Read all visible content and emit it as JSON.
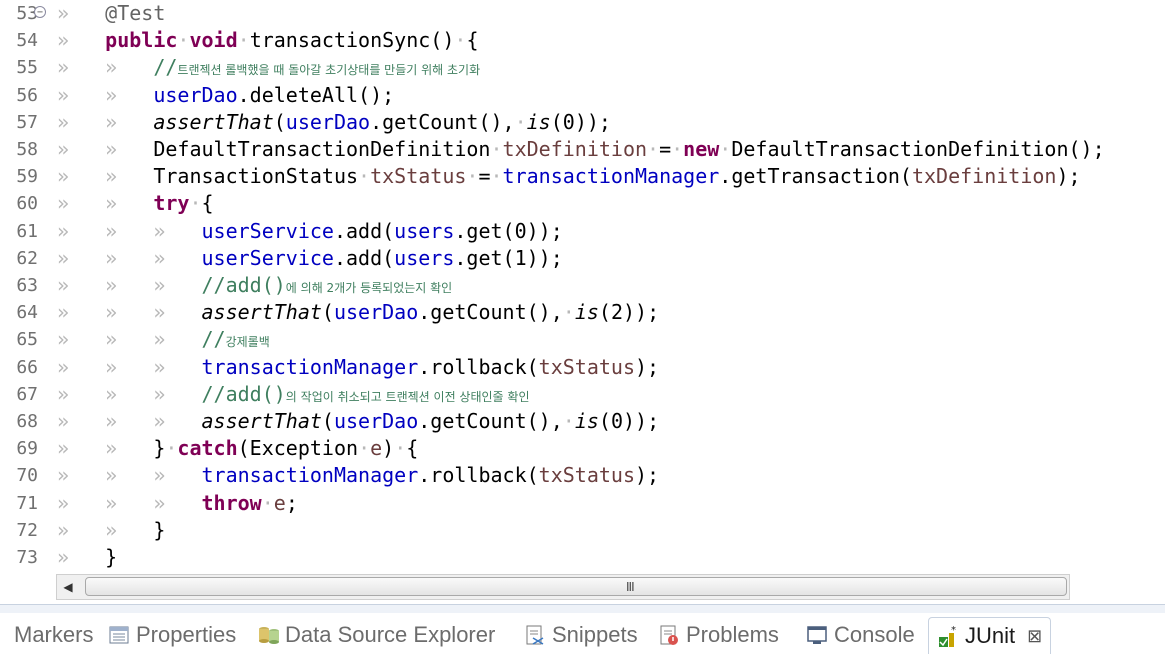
{
  "editor": {
    "lines": [
      {
        "n": "53",
        "html": "<span class=\"ws\">»&nbsp;&nbsp;&nbsp;</span><span class=\"ann\">@Test</span>"
      },
      {
        "n": "54",
        "html": "<span class=\"ws\">»&nbsp;&nbsp;&nbsp;</span><span class=\"kw\">public</span><span class=\"ws\">·</span><span class=\"kw\">void</span><span class=\"ws\">·</span>transactionSync()<span class=\"ws\">·</span>{"
      },
      {
        "n": "55",
        "html": "<span class=\"ws\">»&nbsp;&nbsp;&nbsp;»&nbsp;&nbsp;&nbsp;</span><span class=\"cmt\">//<span class=\"cmtk\">트랜젝션 롤백했을 때 돌아갈 초기상태를 만들기 위해 초기화</span></span>"
      },
      {
        "n": "56",
        "html": "<span class=\"ws\">»&nbsp;&nbsp;&nbsp;»&nbsp;&nbsp;&nbsp;</span><span class=\"fld\">userDao</span>.deleteAll();"
      },
      {
        "n": "57",
        "html": "<span class=\"ws\">»&nbsp;&nbsp;&nbsp;»&nbsp;&nbsp;&nbsp;</span><span class=\"it\">assertThat</span>(<span class=\"fld\">userDao</span>.getCount(),<span class=\"ws\">·</span><span class=\"it\">is</span>(0));"
      },
      {
        "n": "58",
        "html": "<span class=\"ws\">»&nbsp;&nbsp;&nbsp;»&nbsp;&nbsp;&nbsp;</span>DefaultTransactionDefinition<span class=\"ws\">·</span><span class=\"loc\">txDefinition</span><span class=\"ws\">·</span>=<span class=\"ws\">·</span><span class=\"kw\">new</span><span class=\"ws\">·</span>DefaultTransactionDefinition();"
      },
      {
        "n": "59",
        "html": "<span class=\"ws\">»&nbsp;&nbsp;&nbsp;»&nbsp;&nbsp;&nbsp;</span>TransactionStatus<span class=\"ws\">·</span><span class=\"loc\">txStatus</span><span class=\"ws\">·</span>=<span class=\"ws\">·</span><span class=\"fld\">transactionManager</span>.getTransaction(<span class=\"loc\">txDefinition</span>);"
      },
      {
        "n": "60",
        "html": "<span class=\"ws\">»&nbsp;&nbsp;&nbsp;»&nbsp;&nbsp;&nbsp;</span><span class=\"kw\">try</span><span class=\"ws\">·</span>{"
      },
      {
        "n": "61",
        "html": "<span class=\"ws\">»&nbsp;&nbsp;&nbsp;»&nbsp;&nbsp;&nbsp;»&nbsp;&nbsp;&nbsp;</span><span class=\"fld\">userService</span>.add(<span class=\"fld\">users</span>.get(0));"
      },
      {
        "n": "62",
        "html": "<span class=\"ws\">»&nbsp;&nbsp;&nbsp;»&nbsp;&nbsp;&nbsp;»&nbsp;&nbsp;&nbsp;</span><span class=\"fld\">userService</span>.add(<span class=\"fld\">users</span>.get(1));"
      },
      {
        "n": "63",
        "html": "<span class=\"ws\">»&nbsp;&nbsp;&nbsp;»&nbsp;&nbsp;&nbsp;»&nbsp;&nbsp;&nbsp;</span><span class=\"cmt\">//add()<span class=\"cmtk\">에 의해 2개가 등록되었는지 확인</span></span>"
      },
      {
        "n": "64",
        "html": "<span class=\"ws\">»&nbsp;&nbsp;&nbsp;»&nbsp;&nbsp;&nbsp;»&nbsp;&nbsp;&nbsp;</span><span class=\"it\">assertThat</span>(<span class=\"fld\">userDao</span>.getCount(),<span class=\"ws\">·</span><span class=\"it\">is</span>(2));"
      },
      {
        "n": "65",
        "html": "<span class=\"ws\">»&nbsp;&nbsp;&nbsp;»&nbsp;&nbsp;&nbsp;»&nbsp;&nbsp;&nbsp;</span><span class=\"cmt\">//<span class=\"cmtk\">강제롤백</span></span>"
      },
      {
        "n": "66",
        "html": "<span class=\"ws\">»&nbsp;&nbsp;&nbsp;»&nbsp;&nbsp;&nbsp;»&nbsp;&nbsp;&nbsp;</span><span class=\"fld\">transactionManager</span>.rollback(<span class=\"loc\">txStatus</span>);"
      },
      {
        "n": "67",
        "html": "<span class=\"ws\">»&nbsp;&nbsp;&nbsp;»&nbsp;&nbsp;&nbsp;»&nbsp;&nbsp;&nbsp;</span><span class=\"cmt\">//add()<span class=\"cmtk\">의 작업이 취소되고 트랜젝션 이전 상태인줄 확인</span></span>"
      },
      {
        "n": "68",
        "html": "<span class=\"ws\">»&nbsp;&nbsp;&nbsp;»&nbsp;&nbsp;&nbsp;»&nbsp;&nbsp;&nbsp;</span><span class=\"it\">assertThat</span>(<span class=\"fld\">userDao</span>.getCount(),<span class=\"ws\">·</span><span class=\"it\">is</span>(0));"
      },
      {
        "n": "69",
        "html": "<span class=\"ws\">»&nbsp;&nbsp;&nbsp;»&nbsp;&nbsp;&nbsp;</span>}<span class=\"ws\">·</span><span class=\"kw\">catch</span>(Exception<span class=\"ws\">·</span><span class=\"loc\">e</span>)<span class=\"ws\">·</span>{"
      },
      {
        "n": "70",
        "html": "<span class=\"ws\">»&nbsp;&nbsp;&nbsp;»&nbsp;&nbsp;&nbsp;»&nbsp;&nbsp;&nbsp;</span><span class=\"fld\">transactionManager</span>.rollback(<span class=\"loc\">txStatus</span>);"
      },
      {
        "n": "71",
        "html": "<span class=\"ws\">»&nbsp;&nbsp;&nbsp;»&nbsp;&nbsp;&nbsp;»&nbsp;&nbsp;&nbsp;</span><span class=\"kw\">throw</span><span class=\"ws\">·</span><span class=\"loc\">e</span>;"
      },
      {
        "n": "72",
        "html": "<span class=\"ws\">»&nbsp;&nbsp;&nbsp;»&nbsp;&nbsp;&nbsp;</span>}"
      },
      {
        "n": "73",
        "html": "<span class=\"ws\">»&nbsp;&nbsp;&nbsp;</span>}"
      }
    ]
  },
  "scrollbar": {
    "left_arrow": "◀",
    "grip": "III"
  },
  "tabs": {
    "markers": "Markers",
    "properties": "Properties",
    "data_source_explorer": "Data Source Explorer",
    "snippets": "Snippets",
    "problems": "Problems",
    "console": "Console",
    "junit": "JUnit",
    "junit_close": "⊠"
  }
}
